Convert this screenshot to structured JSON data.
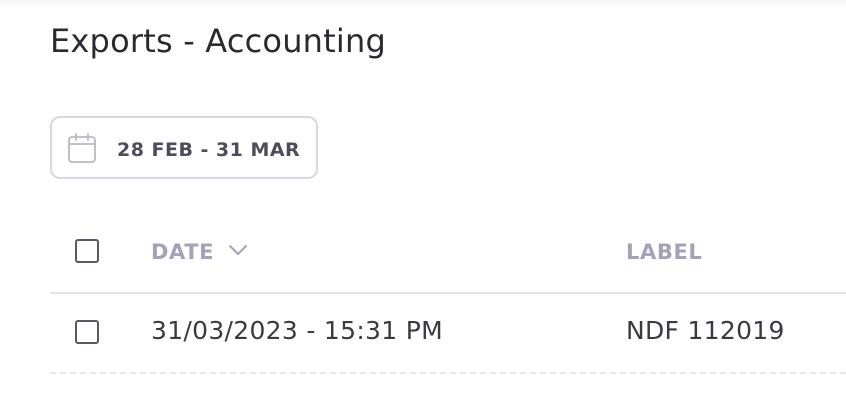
{
  "page": {
    "title": "Exports - Accounting"
  },
  "date_filter": {
    "icon": "calendar-icon",
    "start": "28 FEB",
    "separator": "-",
    "end": "31 MAR"
  },
  "table": {
    "columns": [
      {
        "label": "DATE",
        "sort_icon": "chevron-down-icon"
      },
      {
        "label": "LABEL"
      }
    ],
    "rows": [
      {
        "date": "31/03/2023 - 15:31 PM",
        "label": "NDF 112019",
        "checked": false
      }
    ]
  },
  "colors": {
    "header_text": "#a3a3b8",
    "border": "#d8d8e4",
    "text": "#2a2a30"
  }
}
